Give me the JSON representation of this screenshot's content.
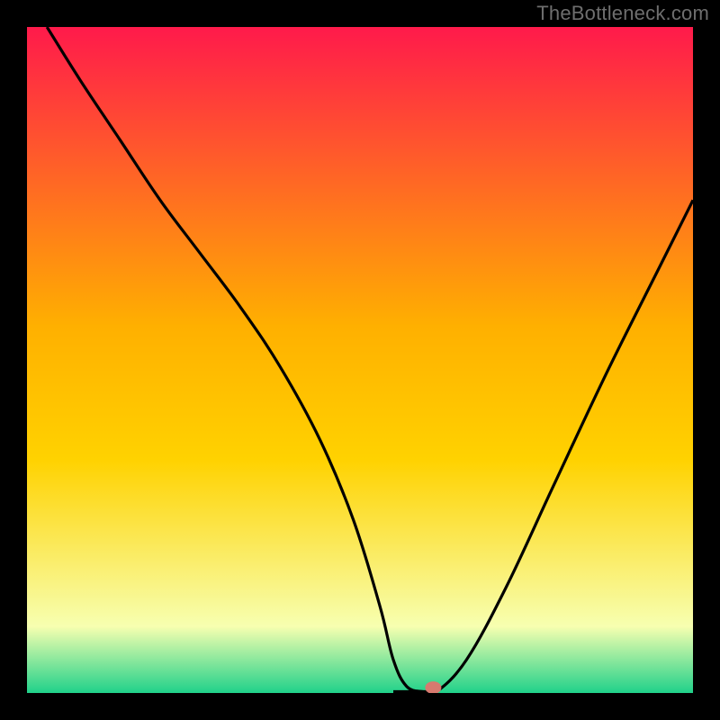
{
  "attribution": "TheBottleneck.com",
  "chart_data": {
    "type": "line",
    "title": "",
    "xlabel": "",
    "ylabel": "",
    "xlim": [
      0,
      100
    ],
    "ylim": [
      0,
      100
    ],
    "gradient_background": {
      "top_color": "#ff1a4b",
      "mid_color": "#ffd200",
      "low_color": "#f7ffb0",
      "bottom_color": "#20d18a"
    },
    "series": [
      {
        "name": "bottleneck-curve",
        "color": "#000000",
        "x": [
          3,
          8,
          14,
          20,
          26,
          32,
          38,
          44,
          49,
          53,
          55,
          57,
          59.5,
          61.5,
          66,
          72,
          79,
          87,
          95,
          100
        ],
        "y": [
          100,
          92,
          83,
          74,
          66,
          58,
          49,
          38,
          26,
          13,
          5,
          1,
          0.2,
          0.2,
          5,
          16,
          31,
          48,
          64,
          74
        ]
      },
      {
        "name": "flat-minimum",
        "color": "#000000",
        "x": [
          55,
          61.5
        ],
        "y": [
          0.2,
          0.2
        ]
      }
    ],
    "marker": {
      "name": "optimal-point",
      "x": 61,
      "y": 0.8,
      "color": "#d77a6f",
      "rx": 9,
      "ry": 7
    }
  }
}
